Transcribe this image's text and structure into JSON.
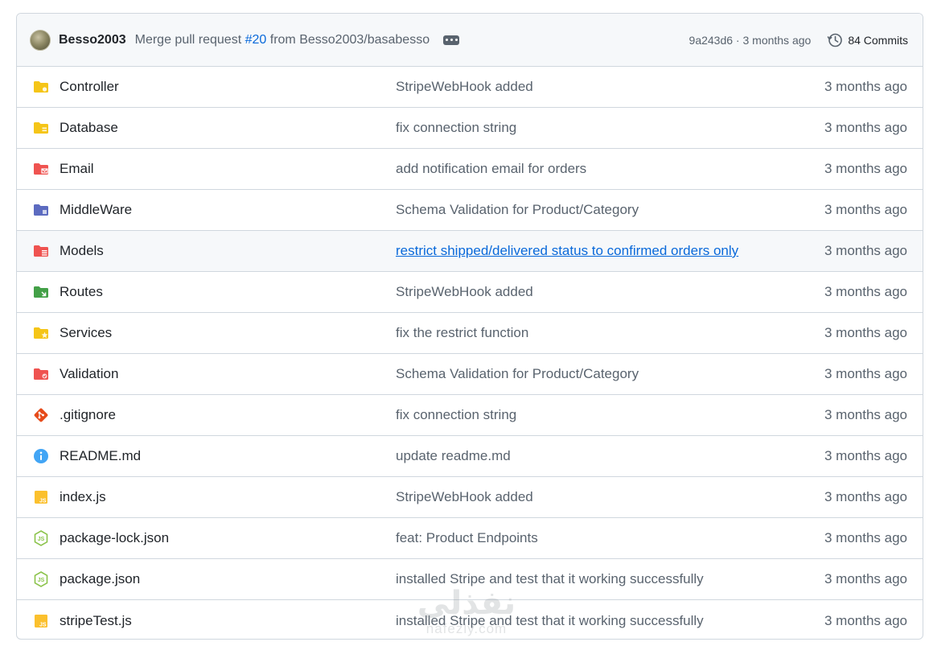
{
  "commit": {
    "author": "Besso2003",
    "message_prefix": "Merge pull request",
    "pr_ref": "#20",
    "message_suffix": "from Besso2003/basabesso",
    "sha_time": "9a243d6 · 3 months ago",
    "commits_label": "84 Commits"
  },
  "files": [
    {
      "name": "Controller",
      "message": "StripeWebHook added",
      "age": "3 months ago",
      "icon": "folder-controller-icon",
      "color": "#f5c518"
    },
    {
      "name": "Database",
      "message": "fix connection string",
      "age": "3 months ago",
      "icon": "folder-database-icon",
      "color": "#f5c518"
    },
    {
      "name": "Email",
      "message": "add notification email for orders",
      "age": "3 months ago",
      "icon": "folder-email-icon",
      "color": "#ef5350"
    },
    {
      "name": "MiddleWare",
      "message": "Schema Validation for Product/Category",
      "age": "3 months ago",
      "icon": "folder-middleware-icon",
      "color": "#5c6bc0"
    },
    {
      "name": "Models",
      "message": "restrict shipped/delivered status to confirmed orders only",
      "age": "3 months ago",
      "icon": "folder-models-icon",
      "color": "#ef5350"
    },
    {
      "name": "Routes",
      "message": "StripeWebHook added",
      "age": "3 months ago",
      "icon": "folder-routes-icon",
      "color": "#43a047"
    },
    {
      "name": "Services",
      "message": "fix the restrict function",
      "age": "3 months ago",
      "icon": "folder-services-icon",
      "color": "#f5c518"
    },
    {
      "name": "Validation",
      "message": "Schema Validation for Product/Category",
      "age": "3 months ago",
      "icon": "folder-validation-icon",
      "color": "#ef5350"
    },
    {
      "name": ".gitignore",
      "message": "fix connection string",
      "age": "3 months ago",
      "icon": "git-icon",
      "color": "#e64a19"
    },
    {
      "name": "README.md",
      "message": "update readme.md",
      "age": "3 months ago",
      "icon": "info-icon",
      "color": "#42a5f5"
    },
    {
      "name": "index.js",
      "message": "StripeWebHook added",
      "age": "3 months ago",
      "icon": "javascript-file-icon",
      "color": "#fbc02d"
    },
    {
      "name": "package-lock.json",
      "message": "feat: Product Endpoints",
      "age": "3 months ago",
      "icon": "nodejs-icon",
      "color": "#8bc34a"
    },
    {
      "name": "package.json",
      "message": "installed Stripe and test that it working successfully",
      "age": "3 months ago",
      "icon": "nodejs-icon",
      "color": "#8bc34a"
    },
    {
      "name": "stripeTest.js",
      "message": "installed Stripe and test that it working successfully",
      "age": "3 months ago",
      "icon": "javascript-file-icon",
      "color": "#fbc02d"
    }
  ],
  "watermark": {
    "arabic": "نفذلي",
    "latin": "nafezly.com"
  }
}
